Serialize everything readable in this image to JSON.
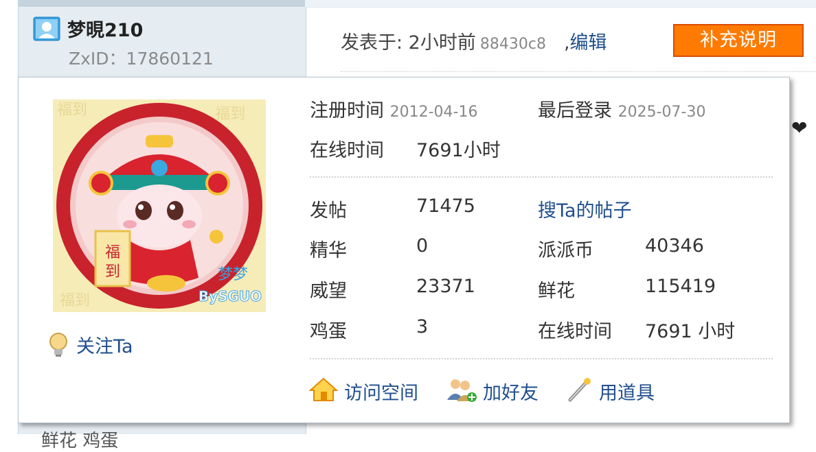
{
  "user": {
    "name": "梦晛210",
    "zxid": "ZxID：17860121"
  },
  "post": {
    "posted_prefix": "发表于: 2小时前",
    "hash": "88430c8",
    "separator": ",",
    "edit_label": "编辑",
    "supplement_label": "补充说明"
  },
  "popup": {
    "reg_label": "注册时间",
    "reg_value": "2012-04-16",
    "last_login_label": "最后登录",
    "last_login_value": "2025-07-30",
    "online_label": "在线时间",
    "online_value": "7691小时",
    "stats": {
      "posts_label": "发帖",
      "posts_value": "71475",
      "search_posts_label": "搜Ta的帖子",
      "essence_label": "精华",
      "essence_value": "0",
      "coins_label": "派派币",
      "coins_value": "40346",
      "prestige_label": "威望",
      "prestige_value": "23371",
      "flowers_label": "鲜花",
      "flowers_value": "115419",
      "eggs_label": "鸡蛋",
      "eggs_value": "3",
      "online_label": "在线时间",
      "online_value": "7691 小时"
    },
    "follow_label": "关注Ta",
    "actions": {
      "visit_space": "访问空间",
      "add_friend": "加好友",
      "use_item": "用道具"
    },
    "avatar": {
      "pattern_text": "福到",
      "sign_text": "梦梦",
      "credit_text": "BySGUO"
    }
  },
  "bottom_peek": "鲜花    鸡蛋",
  "colors": {
    "link": "#1f4e8e",
    "button": "#ff7a00",
    "button_border": "#d94b00",
    "panel_bg": "#e5edf2"
  }
}
